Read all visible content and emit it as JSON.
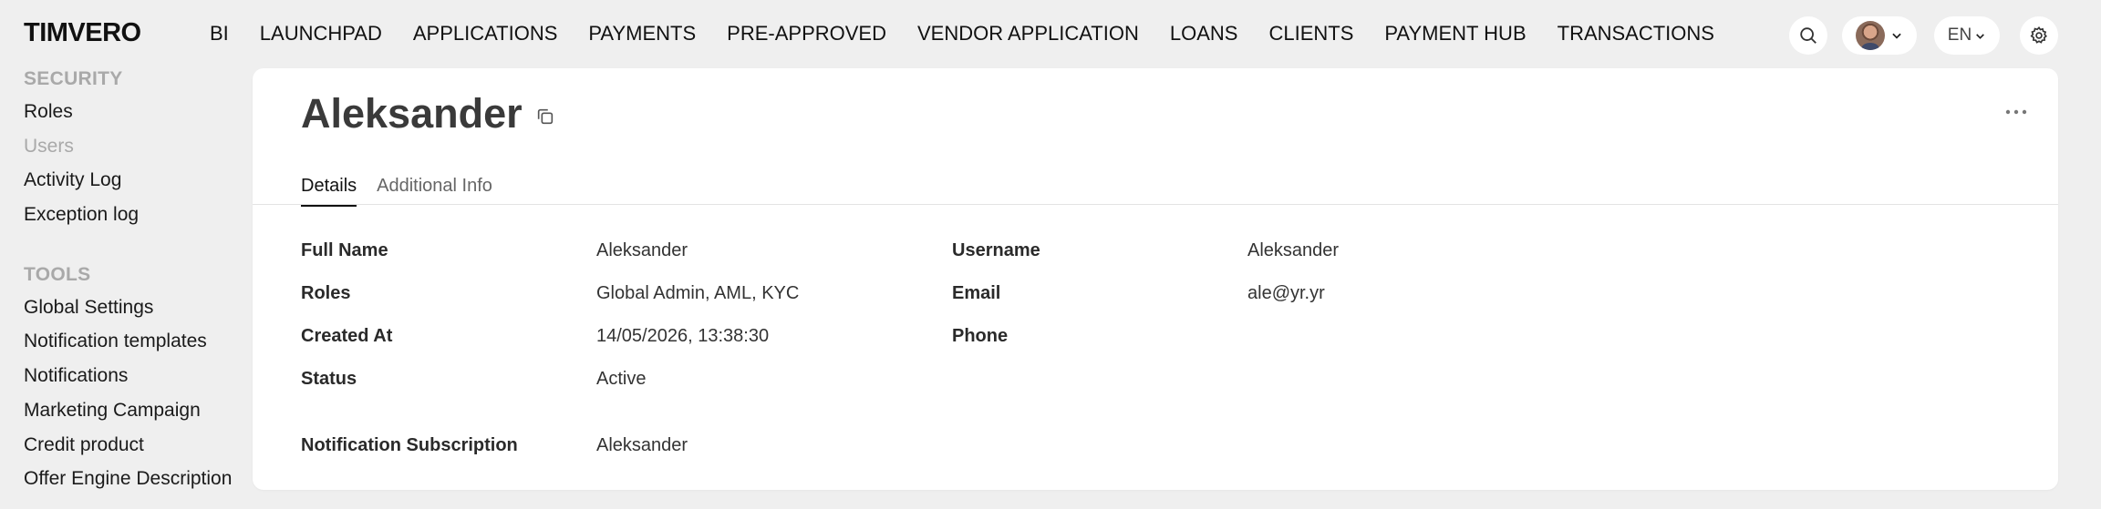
{
  "app": {
    "logo": "TIMVERO"
  },
  "nav": {
    "items": [
      "BI",
      "LAUNCHPAD",
      "APPLICATIONS",
      "PAYMENTS",
      "PRE-APPROVED",
      "VENDOR APPLICATION",
      "LOANS",
      "CLIENTS",
      "PAYMENT HUB",
      "TRANSACTIONS"
    ]
  },
  "header": {
    "language": "EN"
  },
  "sidebar": {
    "security_heading": "SECURITY",
    "security_items": [
      "Roles",
      "Users",
      "Activity Log",
      "Exception log"
    ],
    "tools_heading": "TOOLS",
    "tools_items": [
      "Global Settings",
      "Notification templates",
      "Notifications",
      "Marketing Campaign",
      "Credit product",
      "Offer Engine Description"
    ]
  },
  "record": {
    "title": "Aleksander",
    "tabs": [
      "Details",
      "Additional Info"
    ],
    "fields_left": [
      {
        "label": "Full Name",
        "value": "Aleksander"
      },
      {
        "label": "Roles",
        "value": "Global Admin, AML, KYC"
      },
      {
        "label": "Created At",
        "value": "14/05/2026, 13:38:30"
      },
      {
        "label": "Status",
        "value": "Active"
      }
    ],
    "fields_right": [
      {
        "label": "Username",
        "value": "Aleksander"
      },
      {
        "label": "Email",
        "value": "ale@yr.yr"
      },
      {
        "label": "Phone",
        "value": ""
      }
    ],
    "subscription": {
      "label": "Notification Subscription",
      "value": "Aleksander"
    }
  }
}
